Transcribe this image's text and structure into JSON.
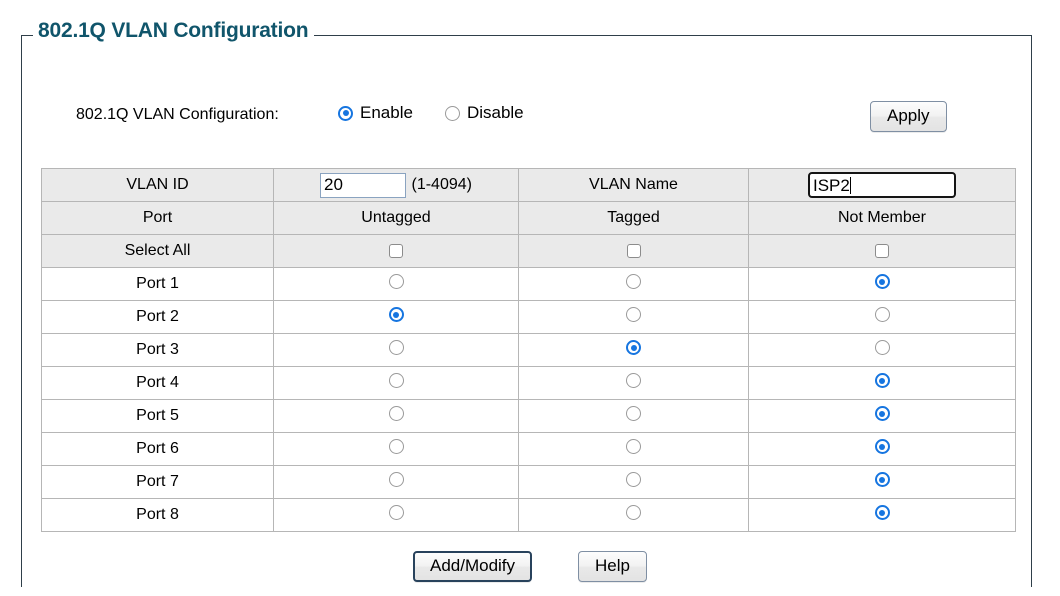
{
  "page": {
    "legend_title": "802.1Q VLAN Configuration"
  },
  "control": {
    "label": "802.1Q VLAN Configuration:",
    "options": [
      {
        "label": "Enable",
        "selected": true
      },
      {
        "label": "Disable",
        "selected": false
      }
    ],
    "apply_label": "Apply"
  },
  "vlan": {
    "id_header": "VLAN ID",
    "id_value": "20",
    "id_range_hint": "(1-4094)",
    "name_header": "VLAN Name",
    "name_value": "ISP2"
  },
  "table": {
    "headers": [
      "Port",
      "Untagged",
      "Tagged",
      "Not Member"
    ],
    "select_all_label": "Select All",
    "select_all_checked": [
      false,
      false,
      false
    ],
    "rows": [
      {
        "port": "Port 1",
        "membership": "not-member"
      },
      {
        "port": "Port 2",
        "membership": "untagged"
      },
      {
        "port": "Port 3",
        "membership": "tagged"
      },
      {
        "port": "Port 4",
        "membership": "not-member"
      },
      {
        "port": "Port 5",
        "membership": "not-member"
      },
      {
        "port": "Port 6",
        "membership": "not-member"
      },
      {
        "port": "Port 7",
        "membership": "not-member"
      },
      {
        "port": "Port 8",
        "membership": "not-member"
      }
    ]
  },
  "footer": {
    "add_modify_label": "Add/Modify",
    "help_label": "Help"
  },
  "colors": {
    "legend_text": "#10556b",
    "radio_accent": "#1675e0",
    "frame_border": "#2f3f4a",
    "table_border": "#b6b6b6",
    "shaded_row_bg": "#eaeaea"
  }
}
